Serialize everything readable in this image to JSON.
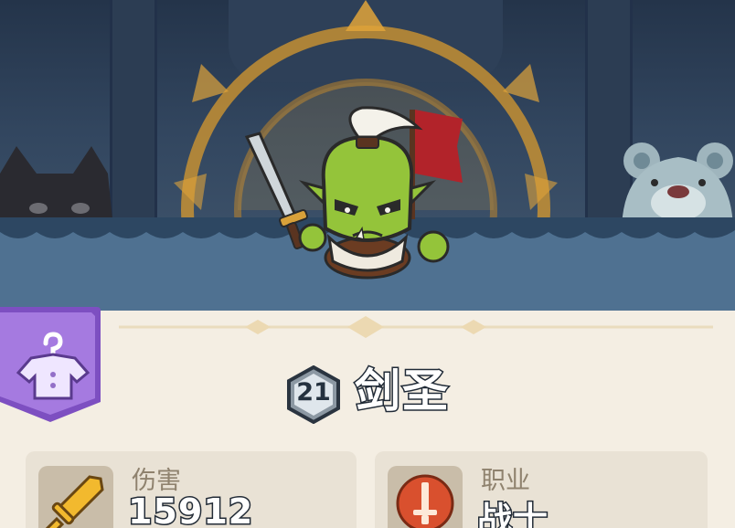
{
  "hero": {
    "level": "21",
    "name": "剑圣"
  },
  "stats": [
    {
      "label": "伤害",
      "value": "15912",
      "icon": "sword-icon"
    },
    {
      "label": "职业",
      "value": "战士",
      "icon": "warrior-class-icon"
    }
  ],
  "colors": {
    "panel": "#f4eee3",
    "badge_purple": "#9b6ad6",
    "platform": "#4f7191",
    "gold": "#d89a2e",
    "orc_green": "#94c43a"
  }
}
